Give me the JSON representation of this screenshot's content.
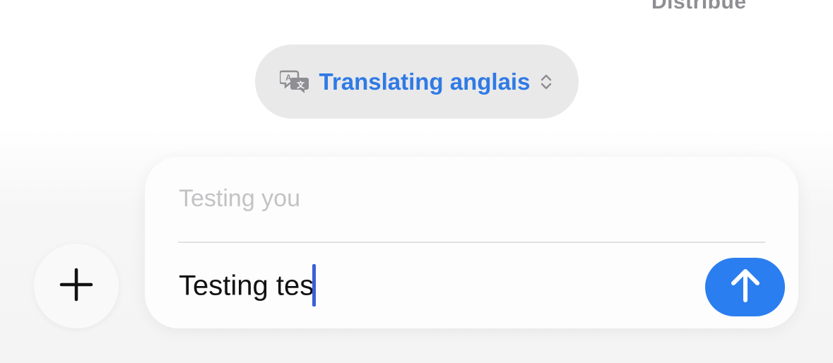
{
  "status": {
    "top_text": "Distribue"
  },
  "translation_mode": {
    "label": "Translating anglais",
    "icon": "translate-icon",
    "chevron_icon": "chevron-updown-icon",
    "accent_color": "#2f7ae5"
  },
  "compose": {
    "translation_preview": "Testing you",
    "input_value": "Testing tes",
    "send_icon": "arrow-up-icon",
    "send_color": "#2b7ef0"
  },
  "attachments": {
    "plus_icon": "plus-icon"
  }
}
